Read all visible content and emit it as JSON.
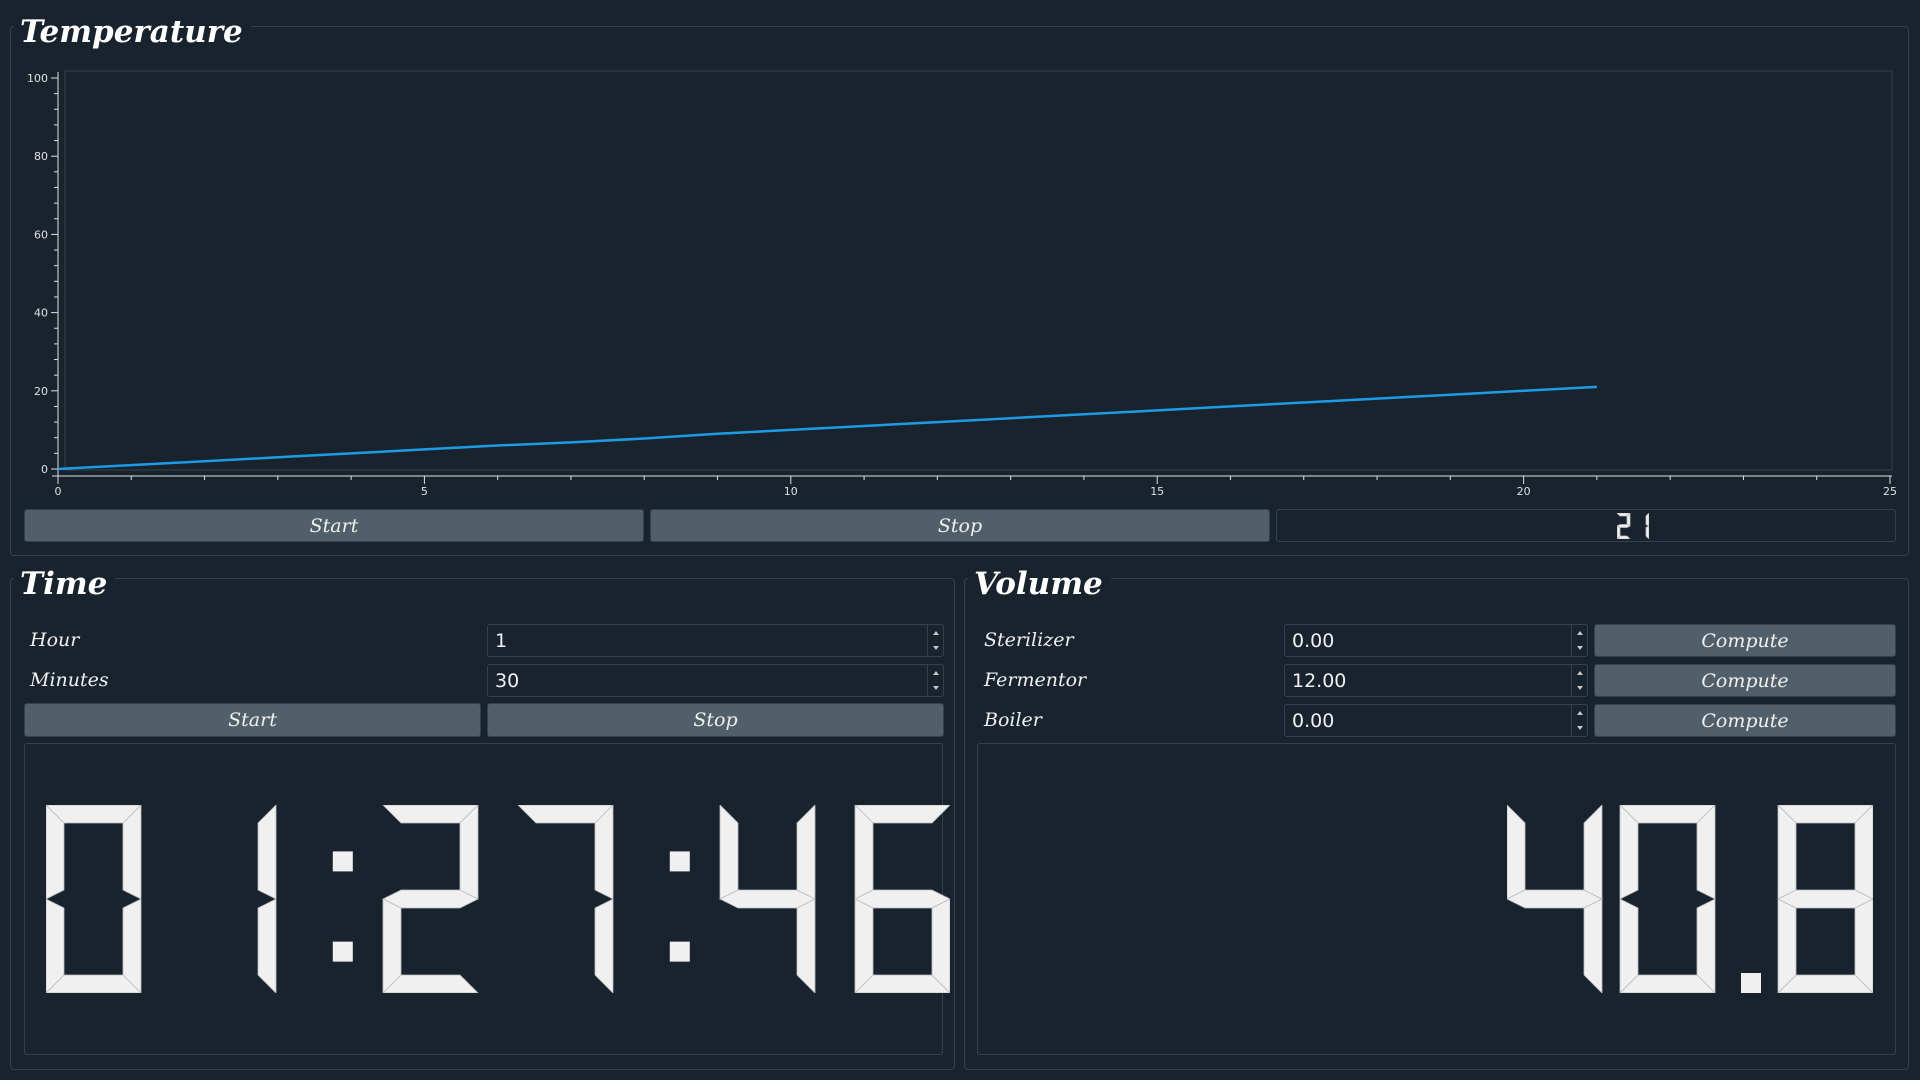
{
  "temperature": {
    "title": "Temperature",
    "start_label": "Start",
    "stop_label": "Stop",
    "lcd_value": "21"
  },
  "chart_data": {
    "type": "line",
    "title": "",
    "xlabel": "",
    "ylabel": "",
    "xlim": [
      0,
      25
    ],
    "ylim": [
      0,
      100
    ],
    "x_ticks": [
      "0",
      "5",
      "10",
      "15",
      "20",
      "25"
    ],
    "y_ticks": [
      "0",
      "20",
      "40",
      "60",
      "80",
      "100"
    ],
    "grid": false,
    "series": [
      {
        "color": "#1e9be6",
        "x": [
          0,
          1,
          2,
          3,
          4,
          5,
          6,
          7,
          8,
          9,
          10,
          11,
          12,
          13,
          14,
          15,
          16,
          17,
          18,
          19,
          20,
          21
        ],
        "y": [
          0,
          1,
          2,
          3,
          4,
          5,
          6,
          6.8,
          7.8,
          9,
          10,
          11,
          12,
          13,
          14,
          15,
          16,
          17,
          18,
          19,
          20,
          21
        ]
      }
    ]
  },
  "time": {
    "title": "Time",
    "hour_label": "Hour",
    "hour_value": "1",
    "minutes_label": "Minutes",
    "minutes_value": "30",
    "start_label": "Start",
    "stop_label": "Stop",
    "lcd_value": "01:27:46"
  },
  "volume": {
    "title": "Volume",
    "rows": [
      {
        "label": "Sterilizer",
        "value": "0.00",
        "button": "Compute"
      },
      {
        "label": "Fermentor",
        "value": "12.00",
        "button": "Compute"
      },
      {
        "label": "Boiler",
        "value": "0.00",
        "button": "Compute"
      }
    ],
    "lcd_value": "40.8"
  },
  "colors": {
    "background": "#19232d",
    "border": "#32414b",
    "button": "#505f69",
    "lcd_digit": "#f0f0f0",
    "series": "#1e9be6"
  }
}
